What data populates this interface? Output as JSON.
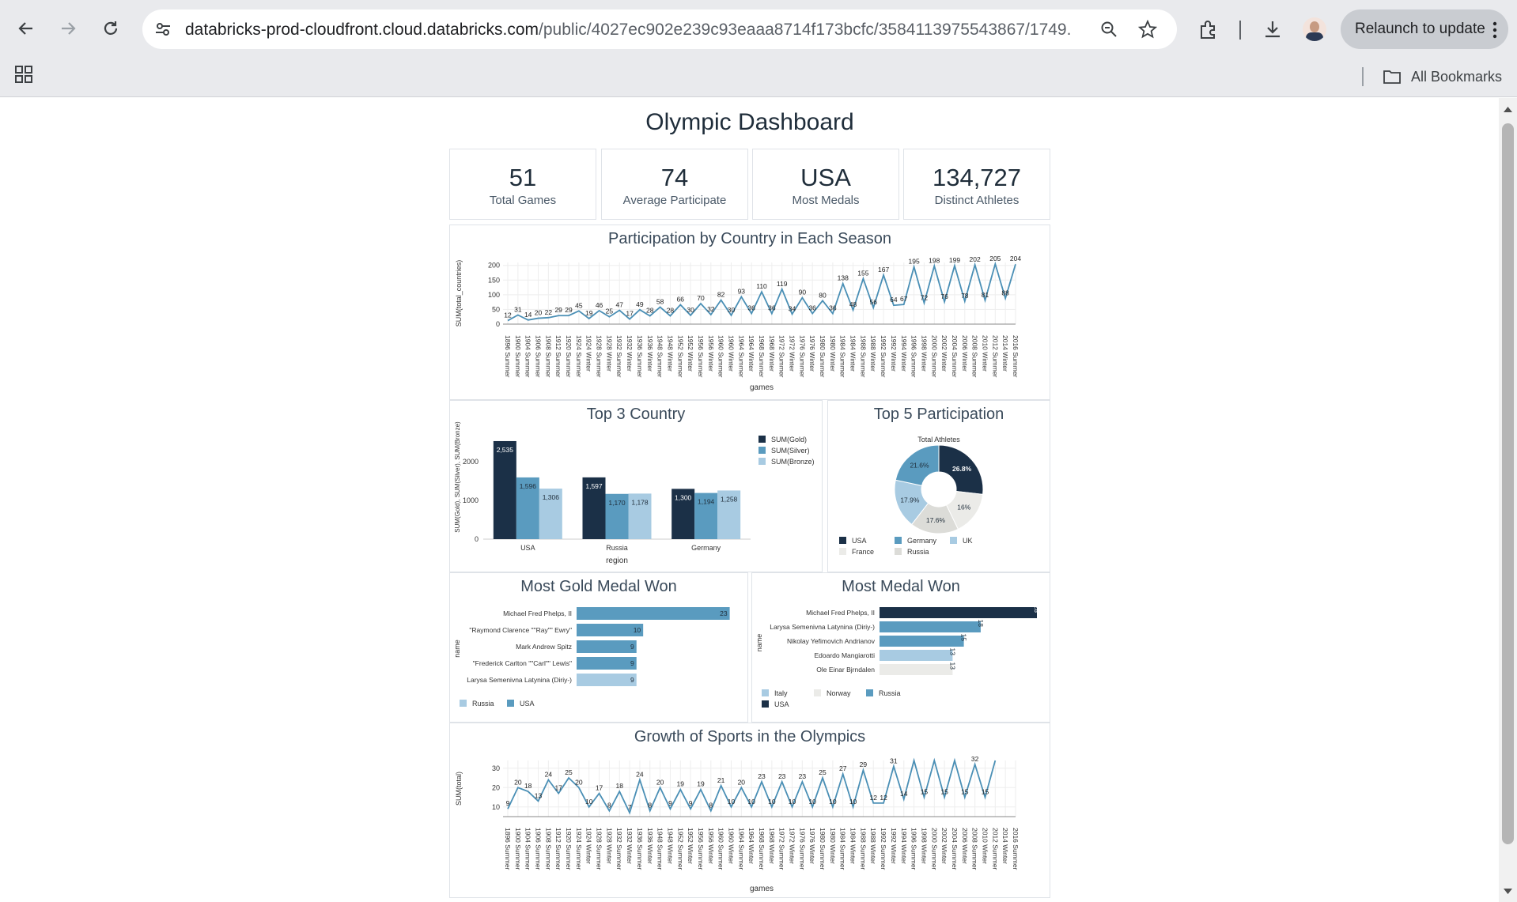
{
  "browser": {
    "url_host": "databricks-prod-cloudfront.cloud.databricks.com",
    "url_path": "/public/4027ec902e239c93eaaa8714f173bcfc/3584113975543867/1749...",
    "relaunch_label": "Relaunch to update",
    "bookmarks_label": "All Bookmarks"
  },
  "dashboard": {
    "title": "Olympic Dashboard",
    "kpis": [
      {
        "value": "51",
        "label": "Total Games"
      },
      {
        "value": "74",
        "label": "Average Participate"
      },
      {
        "value": "USA",
        "label": "Most Medals"
      },
      {
        "value": "134,727",
        "label": "Distinct Athletes"
      }
    ]
  },
  "games": [
    "1896 Summer",
    "1900 Summer",
    "1904 Summer",
    "1906 Summer",
    "1908 Summer",
    "1912 Summer",
    "1920 Summer",
    "1924 Summer",
    "1924 Winter",
    "1928 Summer",
    "1928 Winter",
    "1932 Summer",
    "1932 Winter",
    "1936 Summer",
    "1936 Winter",
    "1948 Summer",
    "1948 Winter",
    "1952 Summer",
    "1952 Winter",
    "1956 Summer",
    "1956 Winter",
    "1960 Summer",
    "1960 Winter",
    "1964 Summer",
    "1964 Winter",
    "1968 Summer",
    "1968 Winter",
    "1972 Summer",
    "1972 Winter",
    "1976 Summer",
    "1976 Winter",
    "1980 Summer",
    "1980 Winter",
    "1984 Summer",
    "1984 Winter",
    "1988 Summer",
    "1988 Winter",
    "1992 Summer",
    "1992 Winter",
    "1994 Winter",
    "1996 Summer",
    "1998 Winter",
    "2000 Summer",
    "2002 Winter",
    "2004 Summer",
    "2006 Winter",
    "2008 Summer",
    "2010 Winter",
    "2012 Summer",
    "2014 Winter",
    "2016 Summer"
  ],
  "chart_data": [
    {
      "type": "line",
      "title": "Participation by Country in Each Season",
      "xlabel": "games",
      "ylabel": "SUM(total_countries)",
      "ylim": [
        0,
        210
      ],
      "yticks": [
        0,
        50,
        100,
        150,
        200
      ],
      "values": [
        12,
        31,
        14,
        20,
        22,
        29,
        29,
        45,
        19,
        46,
        25,
        47,
        17,
        49,
        28,
        58,
        28,
        66,
        30,
        70,
        32,
        82,
        30,
        93,
        36,
        110,
        36,
        119,
        34,
        90,
        36,
        80,
        36,
        138,
        48,
        155,
        56,
        167,
        64,
        67,
        195,
        72,
        198,
        76,
        199,
        78,
        202,
        81,
        205,
        88,
        204
      ],
      "labels": [
        "12",
        "31",
        "14",
        "20",
        "22",
        "29",
        "29",
        "45",
        "19",
        "46",
        "25",
        "47",
        "17",
        "49",
        "28",
        "58",
        "28",
        "66",
        "30",
        "70",
        "32",
        "82",
        "30",
        "93",
        "36",
        "110",
        "36",
        "119",
        "34",
        "90",
        "36",
        "80",
        "36",
        "138",
        "48",
        "155",
        "56",
        "167",
        "64",
        "67",
        "195",
        "72",
        "198",
        "76",
        "199",
        "78",
        "202",
        "81",
        "205",
        "88",
        "204"
      ],
      "color": "#4a8fb5"
    },
    {
      "type": "bar",
      "title": "Top 3 Country",
      "xlabel": "region",
      "ylabel": "SUM(Gold), SUM(Silver), SUM(Bronze)",
      "categories": [
        "USA",
        "Russia",
        "Germany"
      ],
      "ylim": [
        0,
        2800
      ],
      "yticks": [
        0,
        1000,
        2000
      ],
      "series": [
        {
          "name": "SUM(Gold)",
          "values": [
            2535,
            1597,
            1300
          ],
          "labels": [
            "2,535",
            "1,597",
            "1,300"
          ],
          "color": "#1b3047"
        },
        {
          "name": "SUM(Silver)",
          "values": [
            1596,
            1170,
            1194
          ],
          "labels": [
            "1,596",
            "1,170",
            "1,194"
          ],
          "color": "#5a9bbf"
        },
        {
          "name": "SUM(Bronze)",
          "values": [
            1306,
            1178,
            1258
          ],
          "labels": [
            "1,306",
            "1,178",
            "1,258"
          ],
          "color": "#a8cbe2"
        }
      ]
    },
    {
      "type": "pie",
      "title": "Top 5 Participation",
      "subtitle": "Total Athletes",
      "slices": [
        {
          "name": "USA",
          "value": 26.8,
          "label": "26.8%",
          "color": "#1b3047"
        },
        {
          "name": "France",
          "value": 16,
          "label": "16%",
          "color": "#ebebe8"
        },
        {
          "name": "Russia",
          "value": 17.6,
          "label": "17.6%",
          "color": "#dcdcd8"
        },
        {
          "name": "UK",
          "value": 17.9,
          "label": "17.9%",
          "color": "#a8cbe2"
        },
        {
          "name": "Germany",
          "value": 21.6,
          "label": "21.6%",
          "color": "#5a9bbf"
        }
      ],
      "legend_order": [
        "USA",
        "Germany",
        "UK",
        "France",
        "Russia"
      ]
    },
    {
      "type": "bar",
      "orientation": "horizontal",
      "title": "Most Gold Medal Won",
      "ylabel": "name",
      "xlim": [
        0,
        24
      ],
      "categories": [
        "Michael Fred Phelps, II",
        "\"Raymond Clarence \"\"Ray\"\" Ewry\"",
        "Mark Andrew Spitz",
        "\"Frederick Carlton \"\"Carl\"\" Lewis\"",
        "Larysa Semenivna Latynina (Diriy-)"
      ],
      "values": [
        23,
        10,
        9,
        9,
        9
      ],
      "regions": [
        "USA",
        "USA",
        "USA",
        "USA",
        "Russia"
      ],
      "legend": [
        {
          "name": "Russia",
          "color": "#a8cbe2"
        },
        {
          "name": "USA",
          "color": "#5a9bbf"
        }
      ]
    },
    {
      "type": "bar",
      "orientation": "horizontal",
      "title": "Most Medal Won",
      "ylabel": "name",
      "xlim": [
        0,
        28
      ],
      "categories": [
        "Michael Fred Phelps, II",
        "Larysa Semenivna Latynina (Diriy-)",
        "Nikolay Yefimovich Andrianov",
        "Edoardo Mangiarotti",
        "Ole Einar Bjrndalen"
      ],
      "values": [
        28,
        18,
        15,
        13,
        13
      ],
      "regions": [
        "USA",
        "Russia",
        "Russia",
        "Italy",
        "Norway"
      ],
      "legend": [
        {
          "name": "Italy",
          "color": "#a8cbe2"
        },
        {
          "name": "Norway",
          "color": "#ebebe8"
        },
        {
          "name": "Russia",
          "color": "#5a9bbf"
        },
        {
          "name": "USA",
          "color": "#1b3047"
        }
      ]
    },
    {
      "type": "line",
      "title": "Growth of Sports in the Olympics",
      "xlabel": "games",
      "ylabel": "SUM(total)",
      "ylim": [
        5,
        34
      ],
      "yticks": [
        10,
        20,
        30
      ],
      "values": [
        9,
        20,
        18,
        13,
        24,
        17,
        25,
        20,
        10,
        17,
        8,
        18,
        7,
        24,
        8,
        20,
        9,
        19,
        9,
        19,
        8,
        21,
        10,
        20,
        10,
        23,
        10,
        23,
        10,
        23,
        10,
        25,
        10,
        27,
        10,
        29,
        12,
        12,
        31,
        14,
        34,
        15,
        34,
        15,
        34,
        15,
        32,
        15,
        34
      ],
      "labels": [
        "9",
        "20",
        "18",
        "13",
        "24",
        "17",
        "25",
        "20",
        "10",
        "17",
        "8",
        "18",
        "7",
        "24",
        "8",
        "20",
        "9",
        "19",
        "9",
        "19",
        "8",
        "21",
        "10",
        "20",
        "10",
        "23",
        "10",
        "23",
        "10",
        "23",
        "10",
        "25",
        "10",
        "27",
        "10",
        "29",
        "12",
        "12",
        "31",
        "14",
        "",
        "15",
        "",
        "15",
        "",
        "15",
        "32",
        "15",
        ""
      ],
      "color": "#4a8fb5"
    }
  ]
}
